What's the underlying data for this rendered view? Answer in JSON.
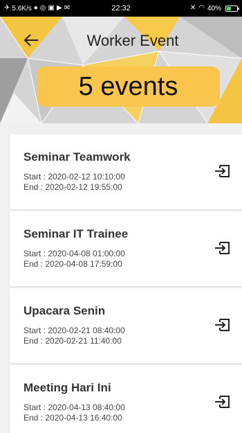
{
  "status_bar": {
    "speed": "5.6K/s",
    "time": "22:32",
    "battery": "40%",
    "battery_level": 0.4
  },
  "header": {
    "title": "Worker Event",
    "event_count": "5 events"
  },
  "events": [
    {
      "title": "Seminar Teamwork",
      "start": "Start :  2020-02-12 10:10:00",
      "end": "End : 2020-02-12 19:55:00"
    },
    {
      "title": "Seminar IT Trainee",
      "start": "Start :  2020-04-08 01:00:00",
      "end": "End : 2020-04-08 17:59:00"
    },
    {
      "title": "Upacara Senin",
      "start": "Start :  2020-02-21 08:40:00",
      "end": "End : 2020-02-21 11:40:00"
    },
    {
      "title": "Meeting Hari Ini",
      "start": "Start :  2020-04-13 08:40:00",
      "end": "End : 2020-04-13 16:40:00"
    }
  ],
  "colors": {
    "accent": "#f9c54d",
    "background": "#f0f0f0"
  },
  "icons": {
    "back": "arrow-left-icon",
    "enter": "login-enter-icon"
  }
}
